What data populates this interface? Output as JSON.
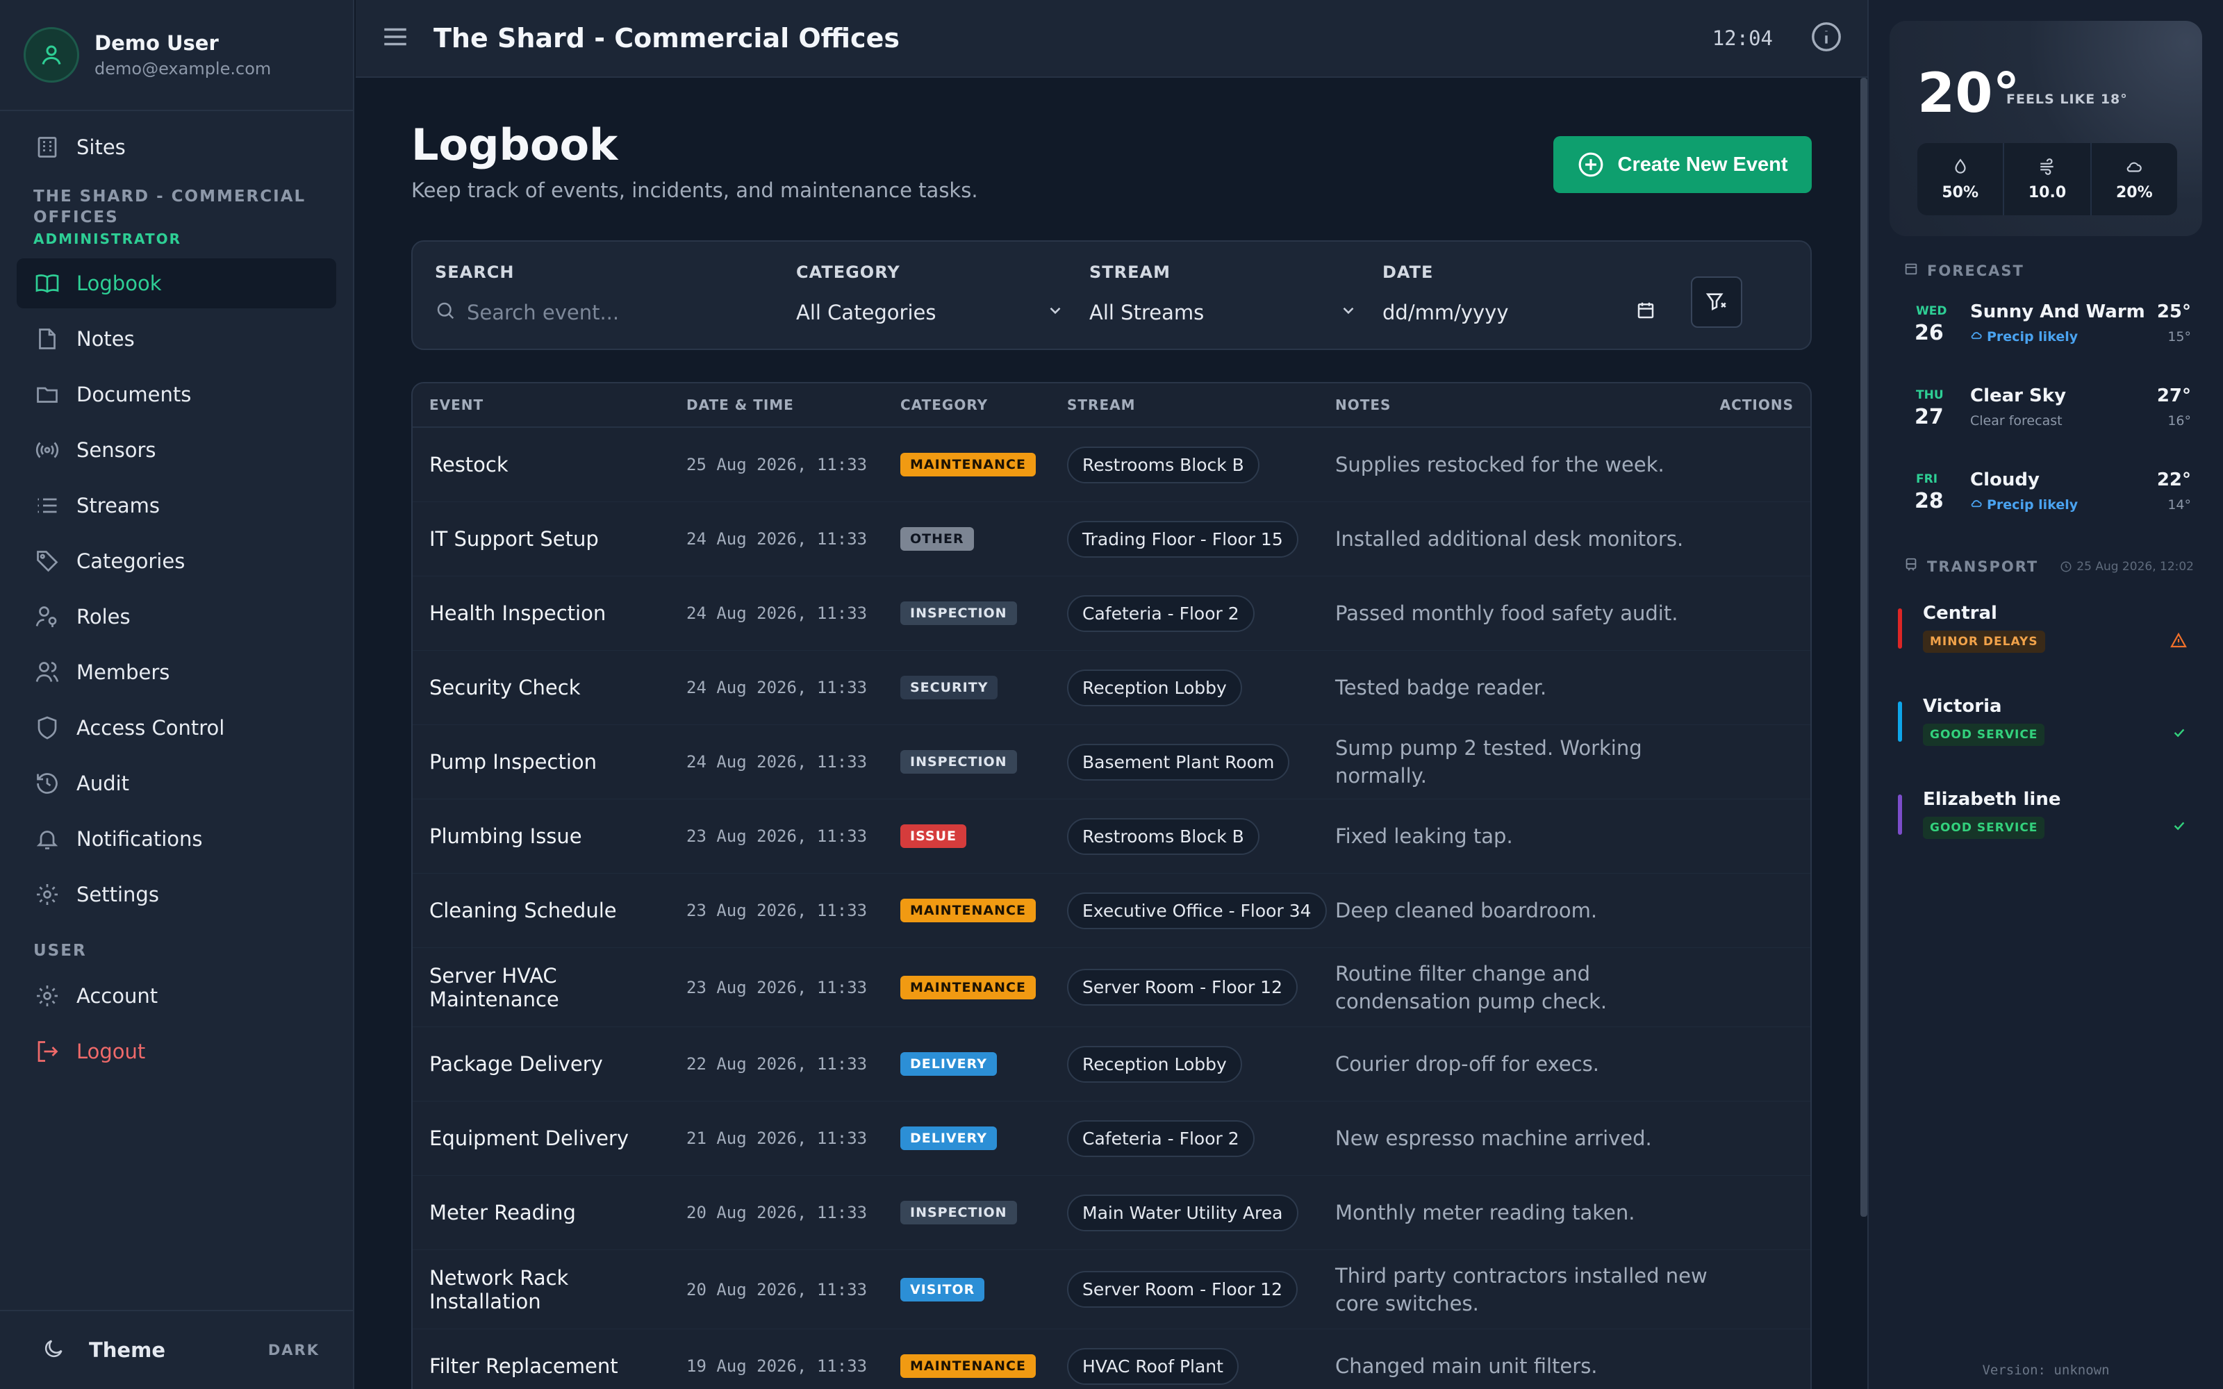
{
  "user": {
    "name": "Demo User",
    "email": "demo@example.com"
  },
  "nav": {
    "sites": "Sites",
    "site_name": "THE SHARD - COMMERCIAL OFFICES",
    "role": "ADMINISTRATOR",
    "items": [
      "Logbook",
      "Notes",
      "Documents",
      "Sensors",
      "Streams",
      "Categories",
      "Roles",
      "Members",
      "Access Control",
      "Audit",
      "Notifications",
      "Settings"
    ],
    "user_section": "USER",
    "account": "Account",
    "logout": "Logout",
    "theme_label": "Theme",
    "theme_value": "DARK"
  },
  "topbar": {
    "title": "The Shard - Commercial Offices",
    "clock": "12:04"
  },
  "page": {
    "title": "Logbook",
    "subtitle": "Keep track of events, incidents, and maintenance tasks.",
    "create_button": "Create New Event"
  },
  "filters": {
    "search_label": "SEARCH",
    "search_placeholder": "Search event...",
    "category_label": "CATEGORY",
    "category_value": "All Categories",
    "stream_label": "STREAM",
    "stream_value": "All Streams",
    "date_label": "DATE",
    "date_value": "dd/mm/yyyy"
  },
  "table": {
    "columns": [
      "EVENT",
      "DATE & TIME",
      "CATEGORY",
      "STREAM",
      "NOTES",
      "ACTIONS"
    ],
    "rows": [
      {
        "event": "Restock",
        "date": "25 Aug 2026, 11:33",
        "category": "MAINTENANCE",
        "stream": "Restrooms Block B",
        "notes": "Supplies restocked for the week."
      },
      {
        "event": "IT Support Setup",
        "date": "24 Aug 2026, 11:33",
        "category": "OTHER",
        "stream": "Trading Floor - Floor 15",
        "notes": "Installed additional desk monitors."
      },
      {
        "event": "Health Inspection",
        "date": "24 Aug 2026, 11:33",
        "category": "INSPECTION",
        "stream": "Cafeteria - Floor 2",
        "notes": "Passed monthly food safety audit."
      },
      {
        "event": "Security Check",
        "date": "24 Aug 2026, 11:33",
        "category": "SECURITY",
        "stream": "Reception Lobby",
        "notes": "Tested badge reader."
      },
      {
        "event": "Pump Inspection",
        "date": "24 Aug 2026, 11:33",
        "category": "INSPECTION",
        "stream": "Basement Plant Room",
        "notes": "Sump pump 2 tested. Working normally."
      },
      {
        "event": "Plumbing Issue",
        "date": "23 Aug 2026, 11:33",
        "category": "ISSUE",
        "stream": "Restrooms Block B",
        "notes": "Fixed leaking tap."
      },
      {
        "event": "Cleaning Schedule",
        "date": "23 Aug 2026, 11:33",
        "category": "MAINTENANCE",
        "stream": "Executive Office - Floor 34",
        "notes": "Deep cleaned boardroom."
      },
      {
        "event": "Server HVAC Maintenance",
        "date": "23 Aug 2026, 11:33",
        "category": "MAINTENANCE",
        "stream": "Server Room - Floor 12",
        "notes": "Routine filter change and condensation pump check."
      },
      {
        "event": "Package Delivery",
        "date": "22 Aug 2026, 11:33",
        "category": "DELIVERY",
        "stream": "Reception Lobby",
        "notes": "Courier drop-off for execs."
      },
      {
        "event": "Equipment Delivery",
        "date": "21 Aug 2026, 11:33",
        "category": "DELIVERY",
        "stream": "Cafeteria - Floor 2",
        "notes": "New espresso machine arrived."
      },
      {
        "event": "Meter Reading",
        "date": "20 Aug 2026, 11:33",
        "category": "INSPECTION",
        "stream": "Main Water Utility Area",
        "notes": "Monthly meter reading taken."
      },
      {
        "event": "Network Rack Installation",
        "date": "20 Aug 2026, 11:33",
        "category": "VISITOR",
        "stream": "Server Room - Floor 12",
        "notes": "Third party contractors installed new core switches."
      },
      {
        "event": "Filter Replacement",
        "date": "19 Aug 2026, 11:33",
        "category": "MAINTENANCE",
        "stream": "HVAC Roof Plant",
        "notes": "Changed main unit filters."
      }
    ]
  },
  "weather": {
    "temp": "20°",
    "feels_like": "FEELS LIKE 18°",
    "humidity": "50%",
    "wind": "10.0",
    "cloud": "20%"
  },
  "forecast": {
    "heading": "FORECAST",
    "days": [
      {
        "dow": "WED",
        "day": "26",
        "desc": "Sunny And Warm",
        "sub": "Precip likely",
        "hi": "25°",
        "lo": "15°",
        "precip": true
      },
      {
        "dow": "THU",
        "day": "27",
        "desc": "Clear Sky",
        "sub": "Clear forecast",
        "hi": "27°",
        "lo": "16°",
        "precip": false
      },
      {
        "dow": "FRI",
        "day": "28",
        "desc": "Cloudy",
        "sub": "Precip likely",
        "hi": "22°",
        "lo": "14°",
        "precip": true
      }
    ]
  },
  "transport": {
    "heading": "TRANSPORT",
    "updated": "25 Aug 2026, 12:02",
    "lines": [
      {
        "name": "Central",
        "status": "MINOR DELAYS",
        "color": "#dc2626"
      },
      {
        "name": "Victoria",
        "status": "GOOD SERVICE",
        "color": "#0ea5e9"
      },
      {
        "name": "Elizabeth line",
        "status": "GOOD SERVICE",
        "color": "#7c4dca"
      }
    ]
  },
  "version": "Version: unknown"
}
